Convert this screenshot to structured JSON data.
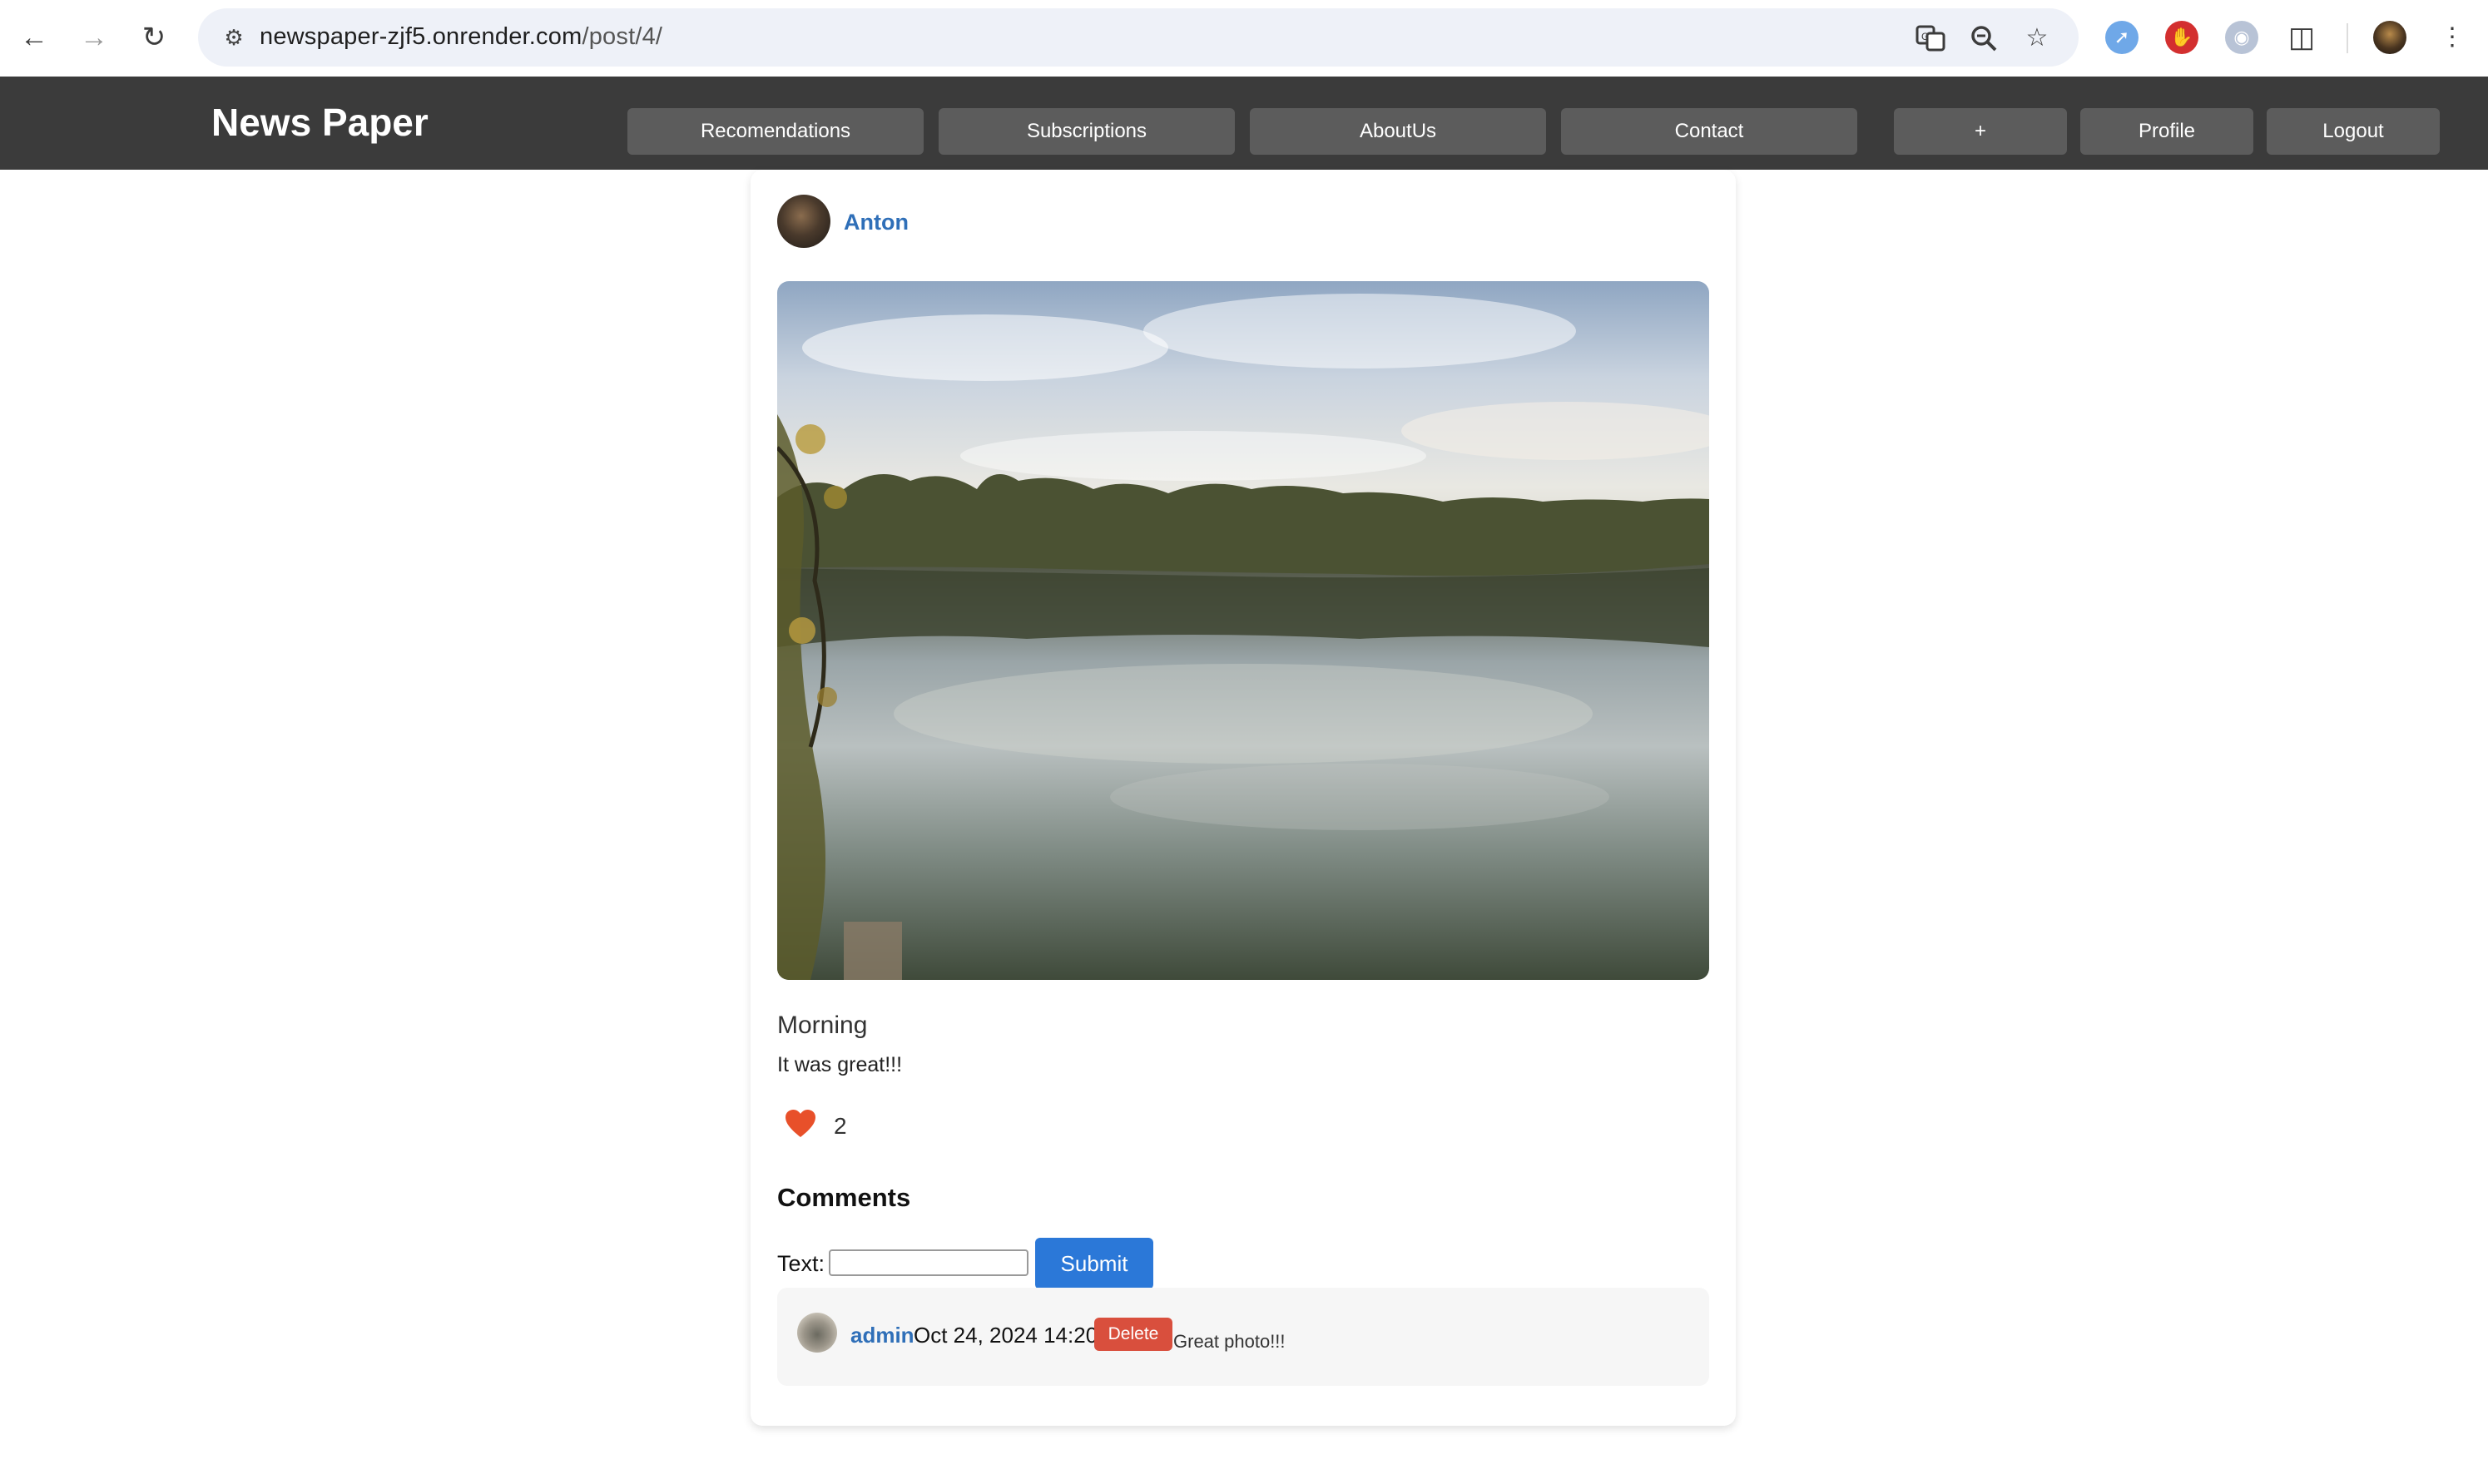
{
  "browser": {
    "url_host": "newspaper-zjf5.onrender.com",
    "url_path": "/post/4/"
  },
  "header": {
    "brand": "News Paper",
    "menu": [
      "Recomendations",
      "Subscriptions",
      "AboutUs",
      "Contact"
    ],
    "actions": [
      "+",
      "Profile",
      "Logout"
    ]
  },
  "post": {
    "author": "Anton",
    "title": "Morning",
    "text": "It was great!!!",
    "likes": "2"
  },
  "comments": {
    "heading": "Comments",
    "form_label": "Text:",
    "input_value": "",
    "submit_label": "Submit",
    "items": [
      {
        "author": "admin",
        "date": "Oct 24, 2024 14:20",
        "delete_label": "Delete",
        "text": "Great photo!!!"
      }
    ]
  },
  "colors": {
    "header_bg": "#3b3b3b",
    "menu_button_bg": "#5c5c5c",
    "link_blue": "#2f6fb8",
    "submit_blue": "#2b78d8",
    "delete_red": "#d94f3d",
    "heart": "#e8502a"
  }
}
